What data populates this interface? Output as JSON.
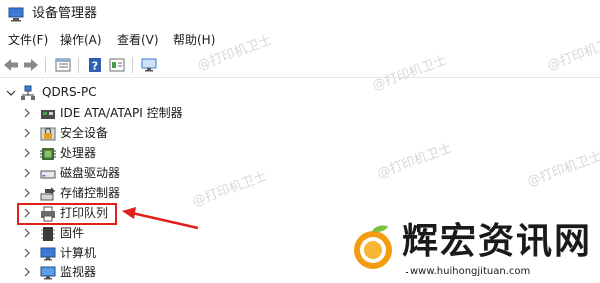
{
  "window": {
    "title": "设备管理器",
    "icon": "device-manager-icon"
  },
  "menu": [
    "文件(F)",
    "操作(A)",
    "查看(V)",
    "帮助(H)"
  ],
  "toolbar": [
    "back-arrow-icon",
    "forward-arrow-icon",
    "properties-grid-icon",
    "help-icon",
    "update-driver-icon",
    "monitor-scan-icon"
  ],
  "tree": {
    "root": "QDRS-PC",
    "items": [
      {
        "label": "IDE ATA/ATAPI 控制器",
        "icon": "ide-controller-icon"
      },
      {
        "label": "安全设备",
        "icon": "security-device-icon"
      },
      {
        "label": "处理器",
        "icon": "processor-icon"
      },
      {
        "label": "磁盘驱动器",
        "icon": "disk-drive-icon"
      },
      {
        "label": "存储控制器",
        "icon": "storage-controller-icon"
      },
      {
        "label": "打印队列",
        "icon": "printer-icon"
      },
      {
        "label": "固件",
        "icon": "firmware-icon"
      },
      {
        "label": "计算机",
        "icon": "computer-icon"
      },
      {
        "label": "监视器",
        "icon": "monitor-icon"
      }
    ]
  },
  "watermark": "@打印机卫士",
  "logo": {
    "text": "辉宏资讯网",
    "url": "www.huihongjituan.com"
  },
  "colors": {
    "accent_red": "#e0201b",
    "orange": "#f39c12",
    "green": "#7cc242"
  }
}
